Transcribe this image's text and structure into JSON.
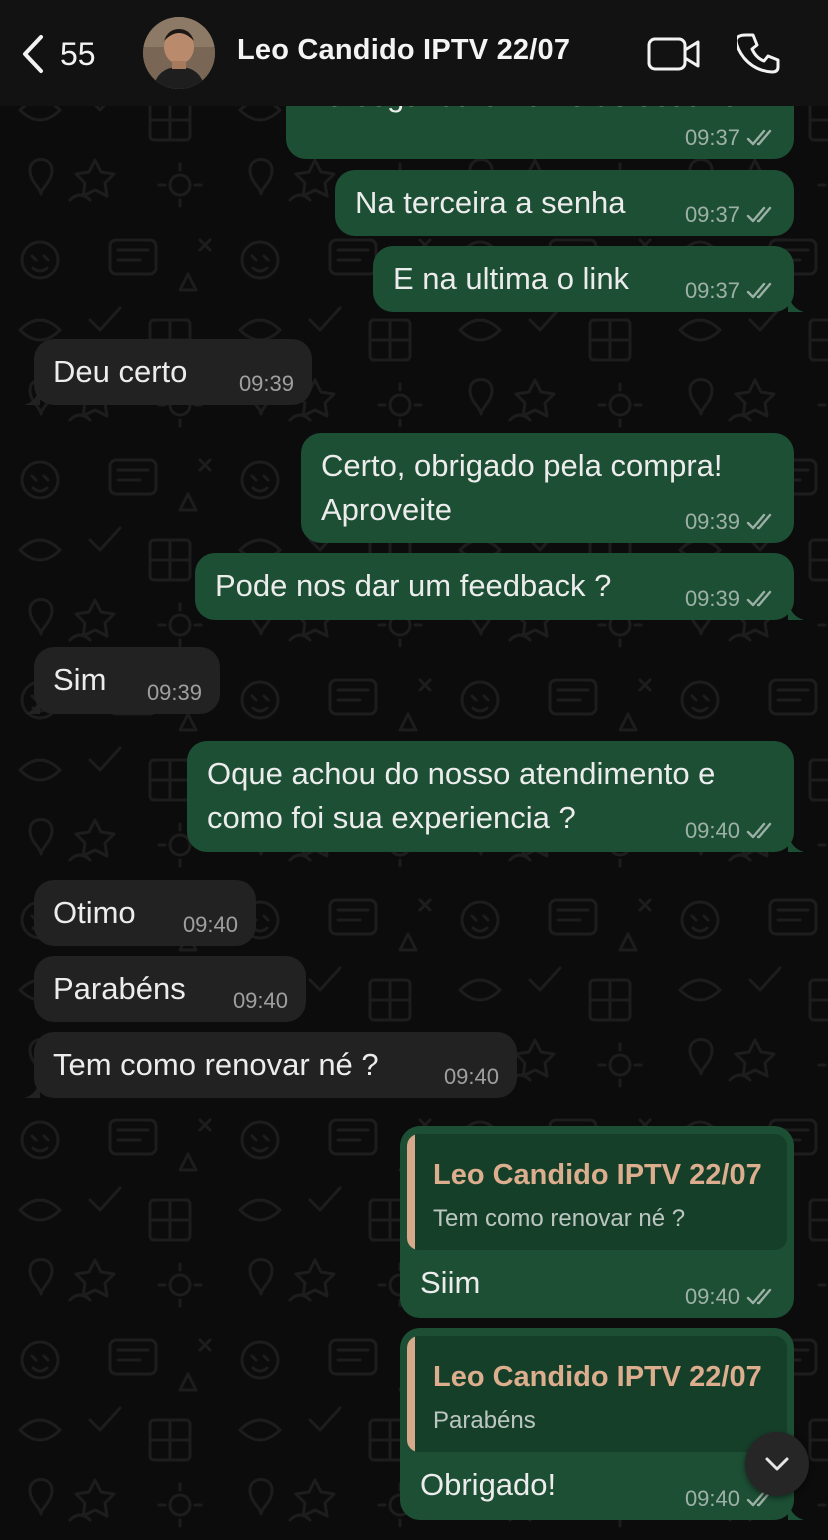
{
  "header": {
    "back_count": "55",
    "contact_name": "Leo Candido IPTV 22/07"
  },
  "messages": [
    {
      "direction": "out",
      "text": "Na segunda o nome de usuário",
      "time": "09:37",
      "status": "read"
    },
    {
      "direction": "out",
      "text": "Na terceira a senha",
      "time": "09:37",
      "status": "read"
    },
    {
      "direction": "out",
      "text": "E na ultima o link",
      "time": "09:37",
      "status": "read"
    },
    {
      "direction": "in",
      "text": "Deu certo",
      "time": "09:39"
    },
    {
      "direction": "out",
      "lines": [
        "Certo, obrigado pela compra!",
        "Aproveite"
      ],
      "time": "09:39",
      "status": "read"
    },
    {
      "direction": "out",
      "text": "Pode nos dar um feedback ?",
      "time": "09:39",
      "status": "read"
    },
    {
      "direction": "in",
      "text": "Sim",
      "time": "09:39"
    },
    {
      "direction": "out",
      "lines": [
        "Oque achou do nosso atendimento e",
        "como foi sua experiencia ?"
      ],
      "time": "09:40",
      "status": "read"
    },
    {
      "direction": "in",
      "text": "Otimo",
      "time": "09:40"
    },
    {
      "direction": "in",
      "text": "Parabéns",
      "time": "09:40"
    },
    {
      "direction": "in",
      "text": "Tem como renovar né ?",
      "time": "09:40"
    },
    {
      "direction": "out",
      "quote": {
        "name": "Leo Candido IPTV 22/07",
        "text": "Tem como renovar né ?"
      },
      "text": "Siim",
      "time": "09:40",
      "status": "read"
    },
    {
      "direction": "out",
      "quote": {
        "name": "Leo Candido IPTV 22/07",
        "text": "Parabéns"
      },
      "text": "Obrigado!",
      "time": "09:40",
      "status": "read"
    }
  ],
  "icons": {
    "back": "chevron-left-icon",
    "video": "video-camera-icon",
    "phone": "phone-icon",
    "read_receipt": "double-check-icon",
    "scroll": "chevron-down-icon"
  },
  "colors": {
    "outgoing_bubble": "#1d4f35",
    "incoming_bubble": "#222222",
    "quote_accent": "#d6a98a",
    "background": "#0c0c0c"
  }
}
